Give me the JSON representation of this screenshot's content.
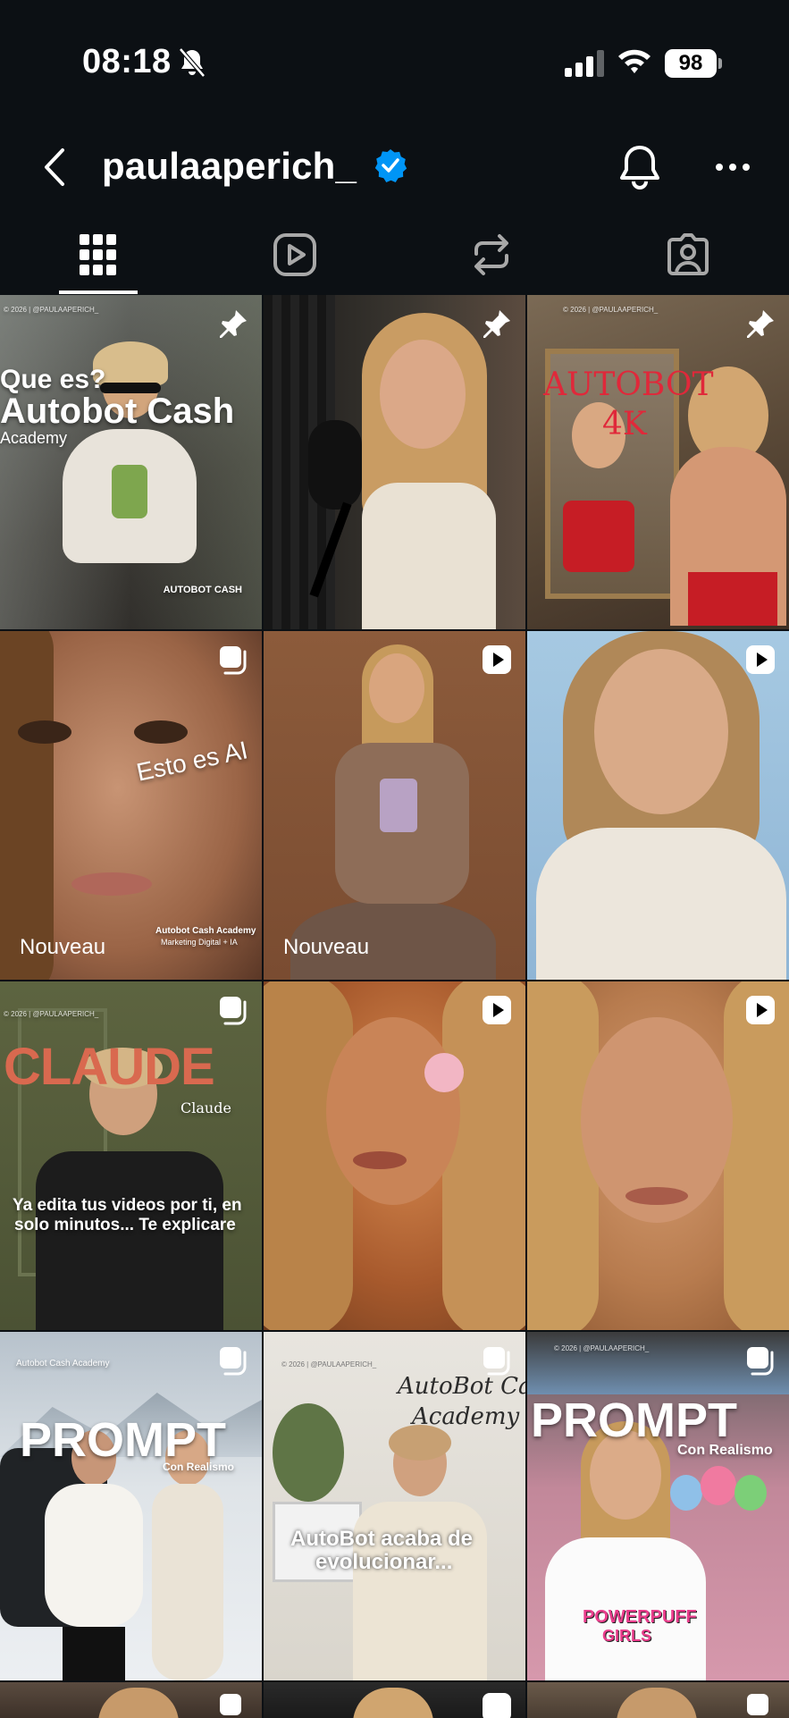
{
  "status_bar": {
    "time": "08:18",
    "battery": "98"
  },
  "profile": {
    "username": "paulaaperich_"
  },
  "tabs": [
    {
      "name": "posts-grid",
      "active": true
    },
    {
      "name": "reels",
      "active": false
    },
    {
      "name": "reposts",
      "active": false
    },
    {
      "name": "tagged",
      "active": false
    }
  ],
  "posts": [
    {
      "badge": "pin-icon",
      "lines": [
        "Que es?",
        "Autobot Cash",
        "Academy"
      ],
      "logo": "AUTOBOT CASH",
      "watermark": "© 2026 | @PAULAAPERICH_"
    },
    {
      "badge": "pin-icon"
    },
    {
      "badge": "pin-icon",
      "lines": [
        "AUTOBOT",
        "4K"
      ],
      "watermark": "© 2026 | @PAULAAPERICH_"
    },
    {
      "badge": "carousel-icon",
      "lines": [
        "Esto es AI"
      ],
      "label": "Nouveau",
      "caption1": "Autobot Cash Academy",
      "caption2": "Marketing Digital + IA"
    },
    {
      "badge": "reel-icon",
      "label": "Nouveau"
    },
    {
      "badge": "reel-icon"
    },
    {
      "badge": "carousel-icon",
      "lines": [
        "CLAUDE",
        "Claude",
        "Ya edita tus videos por ti, en",
        "solo minutos... Te explicare"
      ],
      "watermark": "© 2026 | @PAULAAPERICH_"
    },
    {
      "badge": "reel-icon"
    },
    {
      "badge": "reel-icon"
    },
    {
      "badge": "carousel-icon",
      "lines": [
        "PROMPT",
        "Con Realismo",
        "Autobot Cash Academy"
      ]
    },
    {
      "badge": "carousel-icon",
      "lines": [
        "AutoBot Cash",
        "Academy",
        "AutoBot acaba de",
        "evolucionar..."
      ],
      "watermark": "© 2026 | @PAULAAPERICH_"
    },
    {
      "badge": "carousel-icon",
      "lines": [
        "PROMPT",
        "Con Realismo",
        "POWERPUFF",
        "GIRLS"
      ],
      "watermark": "© 2026 | @PAULAAPERICH_"
    },
    {
      "badge": "carousel-icon"
    },
    {
      "badge": "reel-icon"
    },
    {
      "badge": "carousel-icon"
    }
  ],
  "colors": {
    "background": "#0c1014",
    "verified": "#0095f6",
    "claude_orange": "#d9694f"
  }
}
